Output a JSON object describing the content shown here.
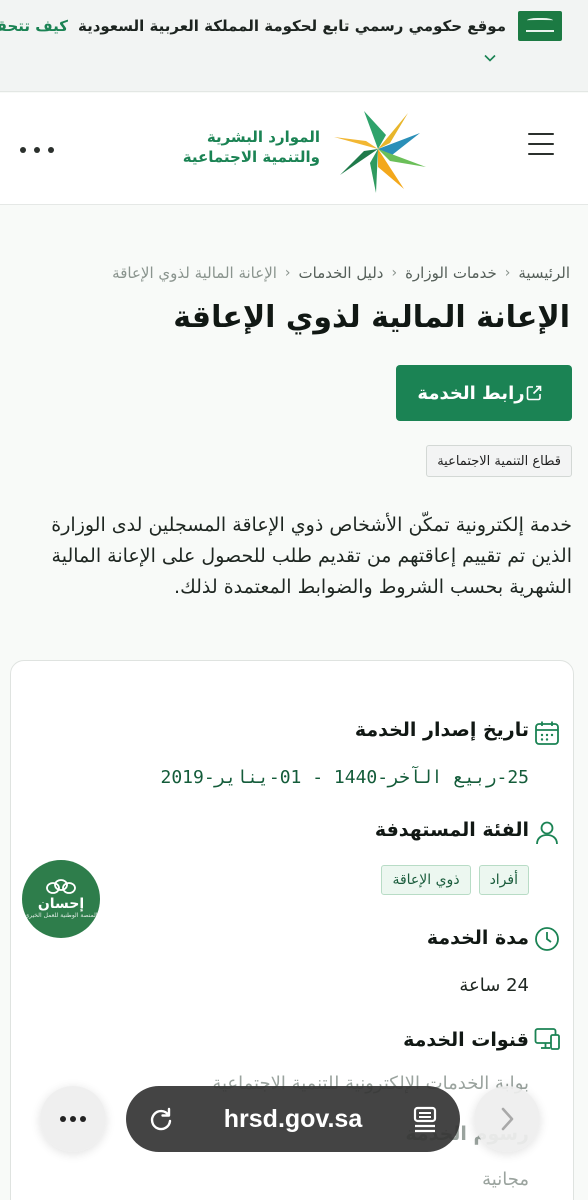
{
  "gov_banner": {
    "text": "موقع حكومي رسمي تابع لحكومة المملكة العربية السعودية",
    "verify_label": "كيف تتحقق"
  },
  "header": {
    "logo_line1": "الموارد البشرية",
    "logo_line2": "والتنمية الاجتماعية"
  },
  "breadcrumb": {
    "items": [
      "الرئيسية",
      "خدمات الوزارة",
      "دليل الخدمات",
      "الإعانة المالية لذوي الإعاقة"
    ]
  },
  "page": {
    "title": "الإعانة المالية لذوي الإعاقة",
    "service_button": "رابط الخدمة",
    "sector_tag": "قطاع التنمية الاجتماعية",
    "description": "خدمة إلكترونية تمكّن الأشخاص ذوي الإعاقة المسجلين لدى الوزارة الذين تم تقييم إعاقتهم من تقديم طلب للحصول على الإعانة المالية الشهرية بحسب الشروط والضوابط المعتمدة لذلك."
  },
  "details": {
    "issue_date_label": "تاريخ إصدار الخدمة",
    "issue_date_value": "25-ربيع الآخر-1440 - 01-يناير-2019",
    "target_label": "الفئة المستهدفة",
    "target_chips": [
      "أفراد",
      "ذوي الإعاقة"
    ],
    "duration_label": "مدة الخدمة",
    "duration_value": "24 ساعة",
    "channels_label": "قنوات الخدمة",
    "channels_value": "بوابة الخدمات الإلكترونية للتنمية الاجتماعية",
    "fees_label": "رسوم الخدمة",
    "fees_value": "مجانية"
  },
  "ehsan_badge": {
    "name": "إحسان",
    "subtitle": "المنصة الوطنية للعمل الخيري"
  },
  "browser": {
    "url": "hrsd.gov.sa"
  }
}
